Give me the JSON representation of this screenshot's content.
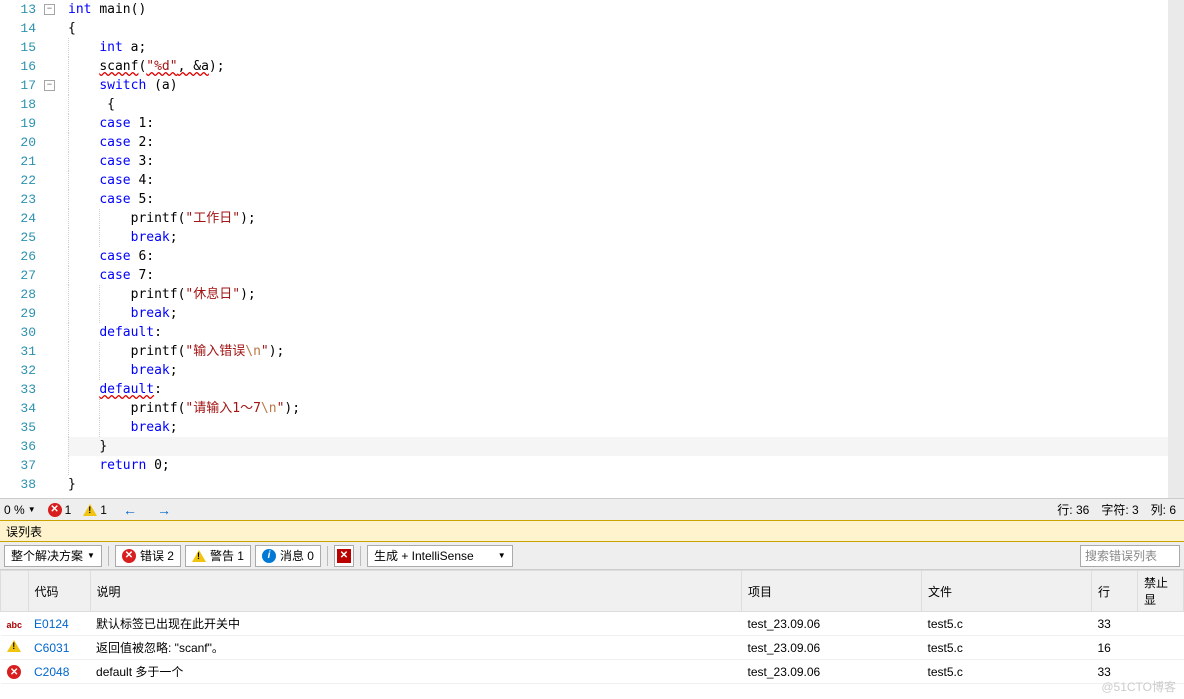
{
  "code": {
    "lines": [
      13,
      14,
      15,
      16,
      17,
      18,
      19,
      20,
      21,
      22,
      23,
      24,
      25,
      26,
      27,
      28,
      29,
      30,
      31,
      32,
      33,
      34,
      35,
      36,
      37,
      38
    ],
    "src": [
      {
        "n": 13,
        "ind": 0,
        "tokens": [
          {
            "t": "int ",
            "c": "kw"
          },
          {
            "t": "main()",
            "c": ""
          }
        ]
      },
      {
        "n": 14,
        "ind": 0,
        "tokens": [
          {
            "t": "{",
            "c": ""
          }
        ]
      },
      {
        "n": 15,
        "ind": 1,
        "tokens": [
          {
            "t": "int ",
            "c": "kw"
          },
          {
            "t": "a;",
            "c": ""
          }
        ]
      },
      {
        "n": 16,
        "ind": 1,
        "tokens": [
          {
            "t": "scanf",
            "c": "squiggle"
          },
          {
            "t": "(",
            "c": ""
          },
          {
            "t": "\"%d\"",
            "c": "str squiggle"
          },
          {
            "t": ", &a",
            "c": "squiggle"
          },
          {
            "t": ");",
            "c": ""
          }
        ]
      },
      {
        "n": 17,
        "ind": 1,
        "tokens": [
          {
            "t": "switch ",
            "c": "kw"
          },
          {
            "t": "(a)",
            "c": ""
          }
        ]
      },
      {
        "n": 18,
        "ind": 1,
        "tokens": [
          {
            "t": " {",
            "c": ""
          }
        ]
      },
      {
        "n": 19,
        "ind": 1,
        "tokens": [
          {
            "t": "case ",
            "c": "kw"
          },
          {
            "t": "1:",
            "c": ""
          }
        ]
      },
      {
        "n": 20,
        "ind": 1,
        "tokens": [
          {
            "t": "case ",
            "c": "kw"
          },
          {
            "t": "2:",
            "c": ""
          }
        ]
      },
      {
        "n": 21,
        "ind": 1,
        "tokens": [
          {
            "t": "case ",
            "c": "kw"
          },
          {
            "t": "3:",
            "c": ""
          }
        ]
      },
      {
        "n": 22,
        "ind": 1,
        "tokens": [
          {
            "t": "case ",
            "c": "kw"
          },
          {
            "t": "4:",
            "c": ""
          }
        ]
      },
      {
        "n": 23,
        "ind": 1,
        "tokens": [
          {
            "t": "case ",
            "c": "kw"
          },
          {
            "t": "5:",
            "c": ""
          }
        ]
      },
      {
        "n": 24,
        "ind": 2,
        "tokens": [
          {
            "t": "printf(",
            "c": ""
          },
          {
            "t": "\"工作日\"",
            "c": "str"
          },
          {
            "t": ");",
            "c": ""
          }
        ]
      },
      {
        "n": 25,
        "ind": 2,
        "tokens": [
          {
            "t": "break",
            "c": "kw"
          },
          {
            "t": ";",
            "c": ""
          }
        ]
      },
      {
        "n": 26,
        "ind": 1,
        "tokens": [
          {
            "t": "case ",
            "c": "kw"
          },
          {
            "t": "6:",
            "c": ""
          }
        ]
      },
      {
        "n": 27,
        "ind": 1,
        "tokens": [
          {
            "t": "case ",
            "c": "kw"
          },
          {
            "t": "7:",
            "c": ""
          }
        ]
      },
      {
        "n": 28,
        "ind": 2,
        "tokens": [
          {
            "t": "printf(",
            "c": ""
          },
          {
            "t": "\"休息日\"",
            "c": "str"
          },
          {
            "t": ");",
            "c": ""
          }
        ]
      },
      {
        "n": 29,
        "ind": 2,
        "tokens": [
          {
            "t": "break",
            "c": "kw"
          },
          {
            "t": ";",
            "c": ""
          }
        ]
      },
      {
        "n": 30,
        "ind": 1,
        "tokens": [
          {
            "t": "default",
            "c": "kw"
          },
          {
            "t": ":",
            "c": ""
          }
        ]
      },
      {
        "n": 31,
        "ind": 2,
        "tokens": [
          {
            "t": "printf(",
            "c": ""
          },
          {
            "t": "\"输入错误",
            "c": "str"
          },
          {
            "t": "\\n",
            "c": "esc"
          },
          {
            "t": "\"",
            "c": "str"
          },
          {
            "t": ");",
            "c": ""
          }
        ]
      },
      {
        "n": 32,
        "ind": 2,
        "tokens": [
          {
            "t": "break",
            "c": "kw"
          },
          {
            "t": ";",
            "c": ""
          }
        ]
      },
      {
        "n": 33,
        "ind": 1,
        "tokens": [
          {
            "t": "default",
            "c": "kw squiggle"
          },
          {
            "t": ":",
            "c": ""
          }
        ]
      },
      {
        "n": 34,
        "ind": 2,
        "tokens": [
          {
            "t": "printf(",
            "c": ""
          },
          {
            "t": "\"请输入1～7",
            "c": "str"
          },
          {
            "t": "\\n",
            "c": "esc"
          },
          {
            "t": "\"",
            "c": "str"
          },
          {
            "t": ");",
            "c": ""
          }
        ]
      },
      {
        "n": 35,
        "ind": 2,
        "tokens": [
          {
            "t": "break",
            "c": "kw"
          },
          {
            "t": ";",
            "c": ""
          }
        ]
      },
      {
        "n": 36,
        "ind": 1,
        "tokens": [
          {
            "t": "}",
            "c": ""
          }
        ],
        "hl": true
      },
      {
        "n": 37,
        "ind": 1,
        "tokens": [
          {
            "t": "return ",
            "c": "kw"
          },
          {
            "t": "0;",
            "c": ""
          }
        ]
      },
      {
        "n": 38,
        "ind": 0,
        "tokens": [
          {
            "t": "}",
            "c": ""
          }
        ]
      }
    ]
  },
  "status": {
    "zoom": "0 %",
    "errors": "1",
    "warnings": "1",
    "pos_line": "行: 36",
    "pos_char": "字符: 3",
    "pos_col": "列: 6"
  },
  "panel": {
    "title": "误列表",
    "solution_dd": "整个解决方案",
    "err_btn": "错误 2",
    "warn_btn": "警告 1",
    "msg_btn": "消息 0",
    "build_dd": "生成 + IntelliSense",
    "search_ph": "搜索错误列表"
  },
  "table": {
    "headers": {
      "code": "代码",
      "desc": "说明",
      "proj": "项目",
      "file": "文件",
      "line": "行",
      "suppress": "禁止显"
    },
    "rows": [
      {
        "icon": "abc",
        "code": "E0124",
        "desc": "默认标签已出现在此开关中",
        "proj": "test_23.09.06",
        "file": "test5.c",
        "line": "33"
      },
      {
        "icon": "warn",
        "code": "C6031",
        "desc": "返回值被忽略: \"scanf\"。",
        "proj": "test_23.09.06",
        "file": "test5.c",
        "line": "16"
      },
      {
        "icon": "err",
        "code": "C2048",
        "desc": "default 多于一个",
        "proj": "test_23.09.06",
        "file": "test5.c",
        "line": "33"
      }
    ]
  },
  "watermark": "@51CTO博客"
}
